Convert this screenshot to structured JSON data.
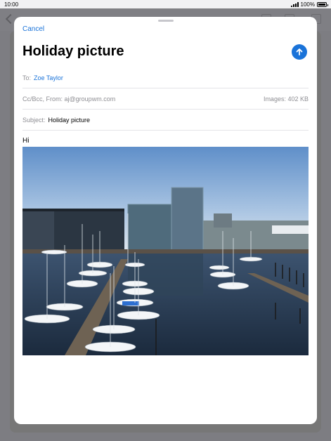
{
  "status_bar": {
    "time": "10:00",
    "battery_percent": "100%"
  },
  "compose": {
    "cancel_label": "Cancel",
    "title": "Holiday picture",
    "to_label": "To:",
    "to_recipient": "Zoe Taylor",
    "cc_from_label": "Cc/Bcc, From:",
    "from_address": "aj@groupwm.com",
    "images_label": "Images:",
    "images_size": "402 KB",
    "subject_label": "Subject:",
    "subject_value": "Holiday picture",
    "body_text": "Hi"
  },
  "icons": {
    "send": "arrow-up-icon",
    "back": "chevron-left-icon"
  },
  "colors": {
    "accent": "#1a73d9"
  }
}
